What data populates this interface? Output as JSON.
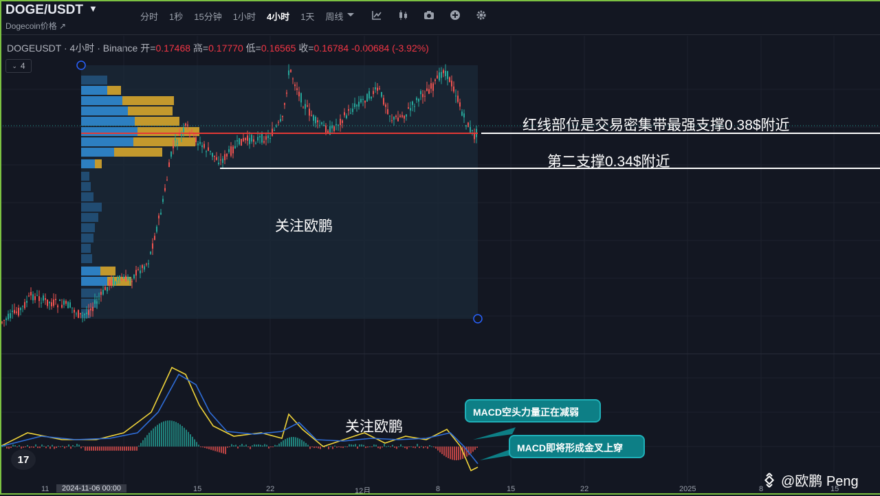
{
  "header": {
    "symbol": "DOGE/USDT",
    "subname": "Dogecoin价格 ↗",
    "timeframes": [
      "分时",
      "1秒",
      "15分钟",
      "1小时",
      "4小时",
      "1天",
      "周线"
    ],
    "active_timeframe": "4小时"
  },
  "legend": {
    "title": "DOGEUSDT · 4小时 · Binance",
    "open_label": "开=",
    "open": "0.17468",
    "high_label": "高=",
    "high": "0.17770",
    "low_label": "低=",
    "low": "0.16565",
    "close_label": "收=",
    "close": "0.16784",
    "change": "-0.00684 (-3.92%)",
    "collapse_count": "4"
  },
  "annotations": {
    "support1": "红线部位是交易密集带最强支撑0.38$附近",
    "support2": "第二支撑0.34$附近",
    "watermark_main": "关注欧鹏",
    "watermark_macd": "关注欧鹏",
    "bubble1": "MACD空头力量正在减弱",
    "bubble2": "MACD即将形成金叉上穿"
  },
  "x_axis": {
    "labels": [
      "11",
      "2024-11-06  00:00",
      "15",
      "22",
      "12月",
      "8",
      "15",
      "22",
      "2025",
      "8",
      "15"
    ]
  },
  "logo_text": "17",
  "credit": "@欧鹏 Peng",
  "colors": {
    "up": "#26a69a",
    "down": "#ef5350",
    "red_line": "#e53935",
    "volume_blue": "#2d7fc1",
    "volume_yellow": "#d6a62c",
    "macd_blue": "#2f6dd8",
    "macd_yellow": "#f0d43a",
    "bubble": "#0d7f86"
  }
}
